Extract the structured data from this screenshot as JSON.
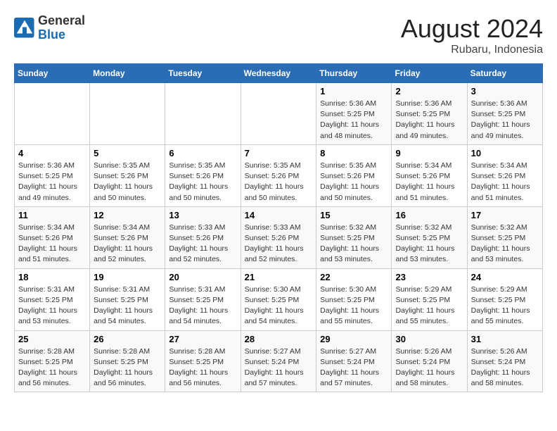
{
  "header": {
    "logo_line1": "General",
    "logo_line2": "Blue",
    "month_year": "August 2024",
    "location": "Rubaru, Indonesia"
  },
  "weekdays": [
    "Sunday",
    "Monday",
    "Tuesday",
    "Wednesday",
    "Thursday",
    "Friday",
    "Saturday"
  ],
  "weeks": [
    [
      {
        "day": "",
        "info": ""
      },
      {
        "day": "",
        "info": ""
      },
      {
        "day": "",
        "info": ""
      },
      {
        "day": "",
        "info": ""
      },
      {
        "day": "1",
        "info": "Sunrise: 5:36 AM\nSunset: 5:25 PM\nDaylight: 11 hours\nand 48 minutes."
      },
      {
        "day": "2",
        "info": "Sunrise: 5:36 AM\nSunset: 5:25 PM\nDaylight: 11 hours\nand 49 minutes."
      },
      {
        "day": "3",
        "info": "Sunrise: 5:36 AM\nSunset: 5:25 PM\nDaylight: 11 hours\nand 49 minutes."
      }
    ],
    [
      {
        "day": "4",
        "info": "Sunrise: 5:36 AM\nSunset: 5:25 PM\nDaylight: 11 hours\nand 49 minutes."
      },
      {
        "day": "5",
        "info": "Sunrise: 5:35 AM\nSunset: 5:26 PM\nDaylight: 11 hours\nand 50 minutes."
      },
      {
        "day": "6",
        "info": "Sunrise: 5:35 AM\nSunset: 5:26 PM\nDaylight: 11 hours\nand 50 minutes."
      },
      {
        "day": "7",
        "info": "Sunrise: 5:35 AM\nSunset: 5:26 PM\nDaylight: 11 hours\nand 50 minutes."
      },
      {
        "day": "8",
        "info": "Sunrise: 5:35 AM\nSunset: 5:26 PM\nDaylight: 11 hours\nand 50 minutes."
      },
      {
        "day": "9",
        "info": "Sunrise: 5:34 AM\nSunset: 5:26 PM\nDaylight: 11 hours\nand 51 minutes."
      },
      {
        "day": "10",
        "info": "Sunrise: 5:34 AM\nSunset: 5:26 PM\nDaylight: 11 hours\nand 51 minutes."
      }
    ],
    [
      {
        "day": "11",
        "info": "Sunrise: 5:34 AM\nSunset: 5:26 PM\nDaylight: 11 hours\nand 51 minutes."
      },
      {
        "day": "12",
        "info": "Sunrise: 5:34 AM\nSunset: 5:26 PM\nDaylight: 11 hours\nand 52 minutes."
      },
      {
        "day": "13",
        "info": "Sunrise: 5:33 AM\nSunset: 5:26 PM\nDaylight: 11 hours\nand 52 minutes."
      },
      {
        "day": "14",
        "info": "Sunrise: 5:33 AM\nSunset: 5:26 PM\nDaylight: 11 hours\nand 52 minutes."
      },
      {
        "day": "15",
        "info": "Sunrise: 5:32 AM\nSunset: 5:25 PM\nDaylight: 11 hours\nand 53 minutes."
      },
      {
        "day": "16",
        "info": "Sunrise: 5:32 AM\nSunset: 5:25 PM\nDaylight: 11 hours\nand 53 minutes."
      },
      {
        "day": "17",
        "info": "Sunrise: 5:32 AM\nSunset: 5:25 PM\nDaylight: 11 hours\nand 53 minutes."
      }
    ],
    [
      {
        "day": "18",
        "info": "Sunrise: 5:31 AM\nSunset: 5:25 PM\nDaylight: 11 hours\nand 53 minutes."
      },
      {
        "day": "19",
        "info": "Sunrise: 5:31 AM\nSunset: 5:25 PM\nDaylight: 11 hours\nand 54 minutes."
      },
      {
        "day": "20",
        "info": "Sunrise: 5:31 AM\nSunset: 5:25 PM\nDaylight: 11 hours\nand 54 minutes."
      },
      {
        "day": "21",
        "info": "Sunrise: 5:30 AM\nSunset: 5:25 PM\nDaylight: 11 hours\nand 54 minutes."
      },
      {
        "day": "22",
        "info": "Sunrise: 5:30 AM\nSunset: 5:25 PM\nDaylight: 11 hours\nand 55 minutes."
      },
      {
        "day": "23",
        "info": "Sunrise: 5:29 AM\nSunset: 5:25 PM\nDaylight: 11 hours\nand 55 minutes."
      },
      {
        "day": "24",
        "info": "Sunrise: 5:29 AM\nSunset: 5:25 PM\nDaylight: 11 hours\nand 55 minutes."
      }
    ],
    [
      {
        "day": "25",
        "info": "Sunrise: 5:28 AM\nSunset: 5:25 PM\nDaylight: 11 hours\nand 56 minutes."
      },
      {
        "day": "26",
        "info": "Sunrise: 5:28 AM\nSunset: 5:25 PM\nDaylight: 11 hours\nand 56 minutes."
      },
      {
        "day": "27",
        "info": "Sunrise: 5:28 AM\nSunset: 5:25 PM\nDaylight: 11 hours\nand 56 minutes."
      },
      {
        "day": "28",
        "info": "Sunrise: 5:27 AM\nSunset: 5:24 PM\nDaylight: 11 hours\nand 57 minutes."
      },
      {
        "day": "29",
        "info": "Sunrise: 5:27 AM\nSunset: 5:24 PM\nDaylight: 11 hours\nand 57 minutes."
      },
      {
        "day": "30",
        "info": "Sunrise: 5:26 AM\nSunset: 5:24 PM\nDaylight: 11 hours\nand 58 minutes."
      },
      {
        "day": "31",
        "info": "Sunrise: 5:26 AM\nSunset: 5:24 PM\nDaylight: 11 hours\nand 58 minutes."
      }
    ]
  ]
}
